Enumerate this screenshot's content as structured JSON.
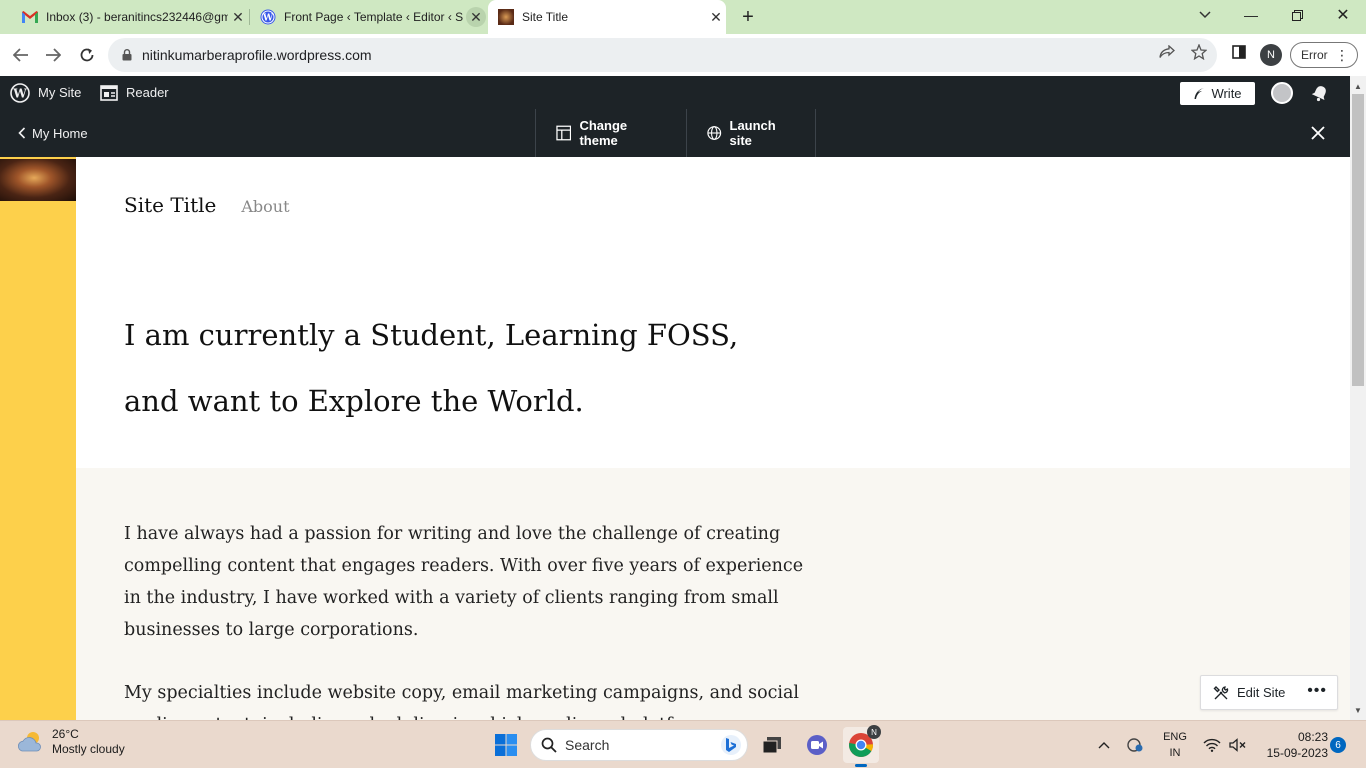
{
  "browser": {
    "tabs": [
      {
        "title": "Inbox (3) - beranitincs232446@gm",
        "icon": "gmail-icon"
      },
      {
        "title": "Front Page ‹ Template ‹ Editor ‹ S",
        "icon": "wordpress-icon"
      },
      {
        "title": "Site Title",
        "icon": "site-favicon"
      }
    ],
    "url": "nitinkumarberaprofile.wordpress.com",
    "profile_initial": "N",
    "error_label": "Error"
  },
  "wp_admin_bar": {
    "my_site": "My Site",
    "reader": "Reader",
    "write": "Write"
  },
  "launch_bar": {
    "my_home": "My Home",
    "change_theme": "Change theme",
    "launch_site": "Launch site"
  },
  "site": {
    "title": "Site Title",
    "nav": [
      "About"
    ],
    "hero_lines": [
      "I am currently a Student, Learning FOSS,",
      "and want to Explore the World."
    ],
    "paragraphs": [
      "I have always had a passion for writing and love the challenge of creating compelling content that engages readers. With over five years of experience in the industry, I have worked with a variety of clients ranging from small businesses to large corporations.",
      "My specialties include website copy, email marketing campaigns, and social media content, including scheduling in which media and platforms"
    ],
    "edit_site": "Edit Site"
  },
  "taskbar": {
    "weather_temp": "26°C",
    "weather_desc": "Mostly cloudy",
    "search_placeholder": "Search",
    "chrome_badge": "N",
    "lang_1": "ENG",
    "lang_2": "IN",
    "time": "08:23",
    "date": "15-09-2023",
    "notification_count": "6"
  }
}
